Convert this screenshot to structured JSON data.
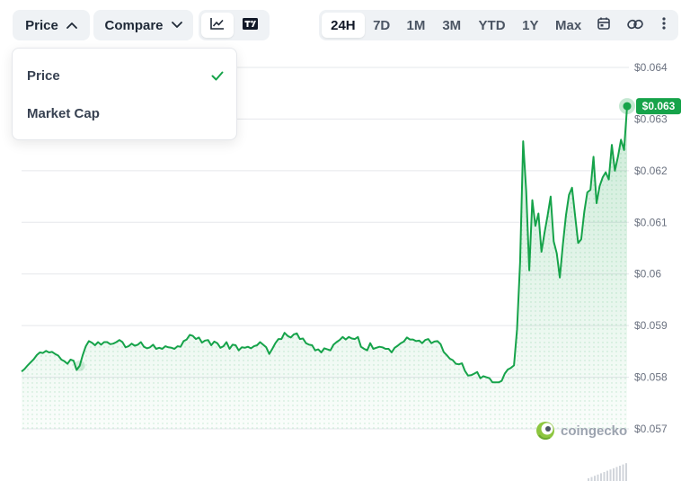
{
  "toolbar": {
    "price_label": "Price",
    "compare_label": "Compare",
    "ranges": [
      "24H",
      "7D",
      "1M",
      "3M",
      "YTD",
      "1Y",
      "Max"
    ],
    "active_range": "24H"
  },
  "dropdown": {
    "items": [
      {
        "label": "Price",
        "selected": true
      },
      {
        "label": "Market Cap",
        "selected": false
      }
    ]
  },
  "brand": {
    "watermark": "coingecko"
  },
  "colors": {
    "line": "#16a34a",
    "badge": "#16a34a",
    "grid": "#e5e7eb"
  },
  "icons": [
    "chevron-up-icon",
    "chevron-down-icon",
    "line-chart-icon",
    "tradingview-icon",
    "calendar-icon",
    "link-icon",
    "more-vertical-icon",
    "check-icon"
  ],
  "chart_data": {
    "type": "area",
    "y_ticks": [
      "$0.064",
      "$0.063",
      "$0.062",
      "$0.061",
      "$0.06",
      "$0.059",
      "$0.058",
      "$0.057"
    ],
    "ylim": [
      0.057,
      0.064
    ],
    "current_price": 0.06325,
    "current_price_label": "$0.063",
    "grid": true,
    "series": [
      {
        "values": [
          0.05811,
          0.05816,
          0.05823,
          0.05829,
          0.05835,
          0.05843,
          0.05848,
          0.05847,
          0.05851,
          0.05848,
          0.05849,
          0.05845,
          0.05842,
          0.05834,
          0.05831,
          0.05826,
          0.05834,
          0.05832,
          0.05814,
          0.05822,
          0.05843,
          0.0586,
          0.0587,
          0.05867,
          0.05862,
          0.05868,
          0.05863,
          0.05868,
          0.05868,
          0.05864,
          0.05865,
          0.05868,
          0.05872,
          0.05868,
          0.05858,
          0.0586,
          0.05865,
          0.05861,
          0.05863,
          0.05868,
          0.05859,
          0.05856,
          0.05858,
          0.05863,
          0.05855,
          0.05857,
          0.05855,
          0.0586,
          0.05858,
          0.05857,
          0.05855,
          0.0586,
          0.05859,
          0.0587,
          0.05873,
          0.05882,
          0.0588,
          0.05874,
          0.05877,
          0.05867,
          0.05871,
          0.05872,
          0.05862,
          0.05869,
          0.05866,
          0.05857,
          0.0586,
          0.05868,
          0.05855,
          0.05863,
          0.05862,
          0.05852,
          0.05858,
          0.05857,
          0.05859,
          0.05856,
          0.0586,
          0.05862,
          0.05868,
          0.05863,
          0.05858,
          0.05845,
          0.05855,
          0.05866,
          0.05874,
          0.05874,
          0.05886,
          0.0588,
          0.05877,
          0.05883,
          0.05885,
          0.05874,
          0.05875,
          0.05866,
          0.05863,
          0.05862,
          0.05852,
          0.05854,
          0.05848,
          0.05856,
          0.05854,
          0.05852,
          0.05863,
          0.05868,
          0.05872,
          0.05878,
          0.05873,
          0.05878,
          0.05875,
          0.05874,
          0.05878,
          0.05859,
          0.05855,
          0.05852,
          0.05866,
          0.05855,
          0.05857,
          0.05859,
          0.05858,
          0.05855,
          0.05855,
          0.05848,
          0.05857,
          0.05861,
          0.05866,
          0.05869,
          0.05877,
          0.05873,
          0.05873,
          0.0587,
          0.05871,
          0.05866,
          0.05872,
          0.05874,
          0.05866,
          0.05869,
          0.0587,
          0.05864,
          0.05849,
          0.05843,
          0.05836,
          0.05833,
          0.05826,
          0.05825,
          0.05827,
          0.05812,
          0.05803,
          0.05804,
          0.05807,
          0.0581,
          0.05798,
          0.05802,
          0.058,
          0.05798,
          0.0579,
          0.0579,
          0.0579,
          0.05793,
          0.05807,
          0.05815,
          0.05818,
          0.05823,
          0.05893,
          0.06023,
          0.06257,
          0.0616,
          0.06007,
          0.06143,
          0.06093,
          0.06117,
          0.06043,
          0.0608,
          0.06113,
          0.0615,
          0.06063,
          0.0604,
          0.05993,
          0.06057,
          0.06113,
          0.06153,
          0.06167,
          0.06113,
          0.0606,
          0.06067,
          0.0612,
          0.06158,
          0.06163,
          0.06227,
          0.06137,
          0.0617,
          0.06187,
          0.06197,
          0.06183,
          0.0625,
          0.062,
          0.06227,
          0.0626,
          0.0624,
          0.06325
        ]
      }
    ]
  }
}
